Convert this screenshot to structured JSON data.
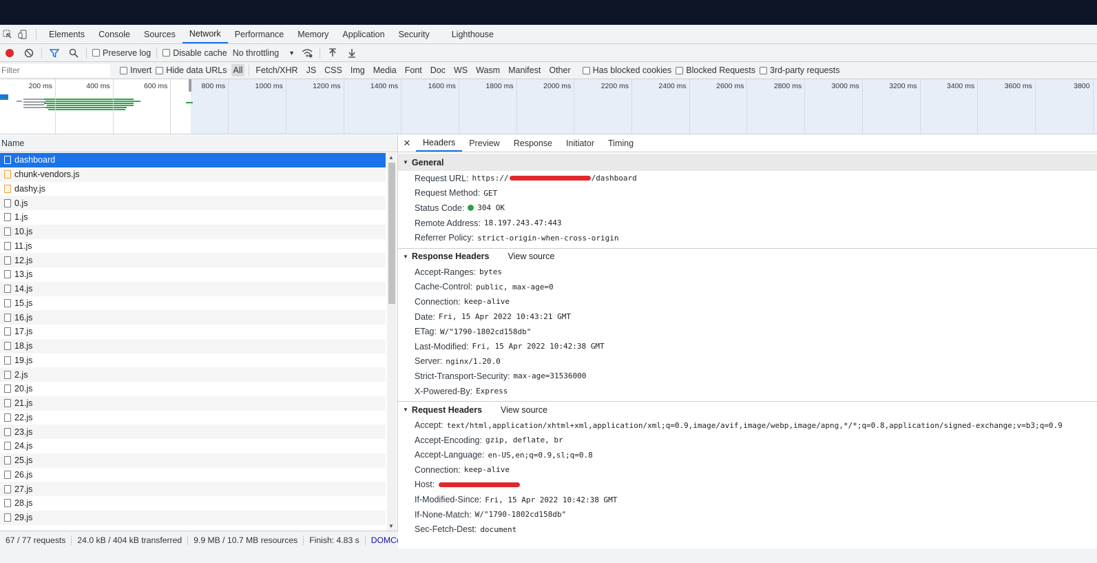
{
  "tabs": [
    "Elements",
    "Console",
    "Sources",
    "Network",
    "Performance",
    "Memory",
    "Application",
    "Security",
    "Lighthouse"
  ],
  "active_tab": "Network",
  "toolbar": {
    "preserve_log": "Preserve log",
    "disable_cache": "Disable cache",
    "throttling": "No throttling"
  },
  "filterbar": {
    "placeholder": "Filter",
    "invert": "Invert",
    "hide_data_urls": "Hide data URLs",
    "types": [
      "All",
      "Fetch/XHR",
      "JS",
      "CSS",
      "Img",
      "Media",
      "Font",
      "Doc",
      "WS",
      "Wasm",
      "Manifest",
      "Other"
    ],
    "has_blocked_cookies": "Has blocked cookies",
    "blocked_requests": "Blocked Requests",
    "third_party": "3rd-party requests"
  },
  "timeline_ticks": [
    "200 ms",
    "400 ms",
    "600 ms",
    "800 ms",
    "1000 ms",
    "1200 ms",
    "1400 ms",
    "1600 ms",
    "1800 ms",
    "2000 ms",
    "2200 ms",
    "2400 ms",
    "2600 ms",
    "2800 ms",
    "3000 ms",
    "3200 ms",
    "3400 ms",
    "3600 ms",
    "3800"
  ],
  "requests": {
    "column": "Name",
    "items": [
      {
        "name": "dashboard",
        "type": "doc"
      },
      {
        "name": "chunk-vendors.js",
        "type": "js"
      },
      {
        "name": "dashy.js",
        "type": "js"
      },
      {
        "name": "0.js",
        "type": "other"
      },
      {
        "name": "1.js",
        "type": "other"
      },
      {
        "name": "10.js",
        "type": "other"
      },
      {
        "name": "11.js",
        "type": "other"
      },
      {
        "name": "12.js",
        "type": "other"
      },
      {
        "name": "13.js",
        "type": "other"
      },
      {
        "name": "14.js",
        "type": "other"
      },
      {
        "name": "15.js",
        "type": "other"
      },
      {
        "name": "16.js",
        "type": "other"
      },
      {
        "name": "17.js",
        "type": "other"
      },
      {
        "name": "18.js",
        "type": "other"
      },
      {
        "name": "19.js",
        "type": "other"
      },
      {
        "name": "2.js",
        "type": "other"
      },
      {
        "name": "20.js",
        "type": "other"
      },
      {
        "name": "21.js",
        "type": "other"
      },
      {
        "name": "22.js",
        "type": "other"
      },
      {
        "name": "23.js",
        "type": "other"
      },
      {
        "name": "24.js",
        "type": "other"
      },
      {
        "name": "25.js",
        "type": "other"
      },
      {
        "name": "26.js",
        "type": "other"
      },
      {
        "name": "27.js",
        "type": "other"
      },
      {
        "name": "28.js",
        "type": "other"
      },
      {
        "name": "29.js",
        "type": "other"
      }
    ]
  },
  "status": {
    "requests": "67 / 77 requests",
    "transferred": "24.0 kB / 404 kB transferred",
    "resources": "9.9 MB / 10.7 MB resources",
    "finish": "Finish: 4.83 s",
    "dom": "DOMConte"
  },
  "detail_tabs": [
    "Headers",
    "Preview",
    "Response",
    "Initiator",
    "Timing"
  ],
  "general": {
    "title": "General",
    "request_url_key": "Request URL:",
    "request_url_prefix": "https://",
    "request_url_suffix": "/dashboard",
    "request_method_key": "Request Method:",
    "request_method": "GET",
    "status_code_key": "Status Code:",
    "status_code": "304 OK",
    "remote_address_key": "Remote Address:",
    "remote_address": "18.197.243.47:443",
    "referrer_policy_key": "Referrer Policy:",
    "referrer_policy": "strict-origin-when-cross-origin"
  },
  "response_headers": {
    "title": "Response Headers",
    "view_source": "View source",
    "rows": [
      {
        "k": "Accept-Ranges:",
        "v": "bytes"
      },
      {
        "k": "Cache-Control:",
        "v": "public, max-age=0"
      },
      {
        "k": "Connection:",
        "v": "keep-alive"
      },
      {
        "k": "Date:",
        "v": "Fri, 15 Apr 2022 10:43:21 GMT"
      },
      {
        "k": "ETag:",
        "v": "W/\"1790-1802cd158db\""
      },
      {
        "k": "Last-Modified:",
        "v": "Fri, 15 Apr 2022 10:42:38 GMT"
      },
      {
        "k": "Server:",
        "v": "nginx/1.20.0"
      },
      {
        "k": "Strict-Transport-Security:",
        "v": "max-age=31536000"
      },
      {
        "k": "X-Powered-By:",
        "v": "Express"
      }
    ]
  },
  "request_headers": {
    "title": "Request Headers",
    "view_source": "View source",
    "rows": [
      {
        "k": "Accept:",
        "v": "text/html,application/xhtml+xml,application/xml;q=0.9,image/avif,image/webp,image/apng,*/*;q=0.8,application/signed-exchange;v=b3;q=0.9"
      },
      {
        "k": "Accept-Encoding:",
        "v": "gzip, deflate, br"
      },
      {
        "k": "Accept-Language:",
        "v": "en-US,en;q=0.9,sl;q=0.8"
      },
      {
        "k": "Connection:",
        "v": "keep-alive"
      },
      {
        "k": "Host:",
        "v": ""
      },
      {
        "k": "If-Modified-Since:",
        "v": "Fri, 15 Apr 2022 10:42:38 GMT"
      },
      {
        "k": "If-None-Match:",
        "v": "W/\"1790-1802cd158db\""
      },
      {
        "k": "Sec-Fetch-Dest:",
        "v": "document"
      }
    ]
  },
  "colors": {
    "accent": "#1a73e8",
    "record": "#e0282b",
    "status_ok": "#2ea043",
    "topbar": "#0d1426"
  }
}
